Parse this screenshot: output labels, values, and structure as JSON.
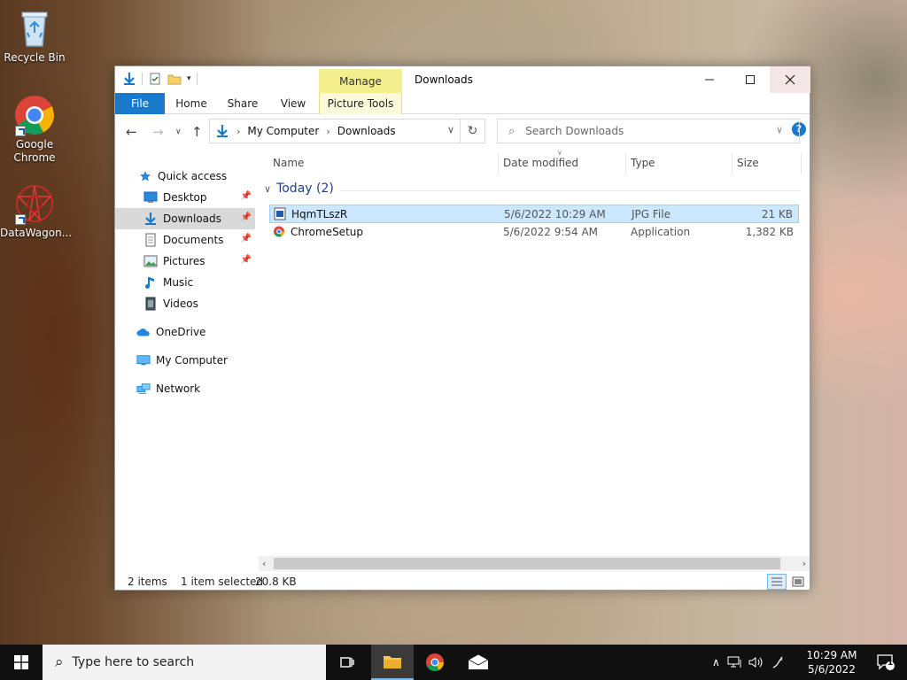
{
  "desktop": {
    "icons": [
      {
        "label": "Recycle Bin"
      },
      {
        "label": "Google Chrome"
      },
      {
        "label": "DataWagon..."
      }
    ]
  },
  "window": {
    "title": "Downloads",
    "context_tab": "Manage",
    "ribbon_tabs": [
      "File",
      "Home",
      "Share",
      "View",
      "Picture Tools"
    ],
    "address": {
      "segments": [
        "My Computer",
        "Downloads"
      ]
    },
    "search_placeholder": "Search Downloads",
    "nav": {
      "quick_access": "Quick access",
      "items": [
        "Desktop",
        "Downloads",
        "Documents",
        "Pictures",
        "Music",
        "Videos"
      ],
      "onedrive": "OneDrive",
      "my_computer": "My Computer",
      "network": "Network"
    },
    "columns": [
      "Name",
      "Date modified",
      "Type",
      "Size"
    ],
    "group": "Today (2)",
    "files": [
      {
        "name": "HqmTLszR",
        "date": "5/6/2022 10:29 AM",
        "type": "JPG File",
        "size": "21 KB",
        "selected": true
      },
      {
        "name": "ChromeSetup",
        "date": "5/6/2022 9:54 AM",
        "type": "Application",
        "size": "1,382 KB",
        "selected": false
      }
    ],
    "status": {
      "items": "2 items",
      "selected": "1 item selected",
      "size": "20.8 KB"
    }
  },
  "taskbar": {
    "search_placeholder": "Type here to search",
    "time": "10:29 AM",
    "date": "5/6/2022",
    "notifications": "1"
  },
  "colors": {
    "accent": "#1979ca",
    "selection": "#cce8ff",
    "manage_tab": "#f4ee8f",
    "taskbar": "#101010"
  }
}
